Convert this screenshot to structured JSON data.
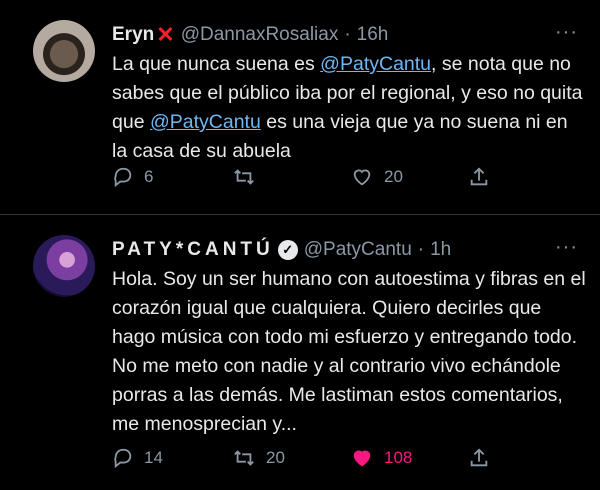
{
  "tweets": [
    {
      "name": "Eryn",
      "name_icon": "red-x-icon",
      "handle": "@DannaxRosaliax",
      "separator": "·",
      "time": "16h",
      "body": [
        {
          "t": "La que nunca suena es "
        },
        {
          "t": "@PatyCantu",
          "mention": true
        },
        {
          "t": ", se nota que no sabes que el público iba por el regional, y eso no quita que "
        },
        {
          "t": "@PatyCantu",
          "mention": true
        },
        {
          "t": "  es una vieja que ya no suena ni en la casa de su abuela"
        }
      ],
      "replies": "6",
      "retweets": "",
      "likes": "20",
      "liked": false
    },
    {
      "name": "PATY*CANTÚ",
      "name_icon": "verified-icon",
      "handle": "@PatyCantu",
      "separator": "·",
      "time": "1h",
      "body": [
        {
          "t": "Hola. Soy un ser humano con autoestima y fibras en el corazón igual que cualquiera. Quiero decirles que hago música con todo mi esfuerzo y entregando todo. No me meto con nadie y al contrario vivo echándole porras a las demás. Me lastiman estos comentarios, me menosprecian y..."
        }
      ],
      "replies": "14",
      "retweets": "20",
      "likes": "108",
      "liked": true
    }
  ],
  "colors": {
    "accent": "#1d9bf0",
    "like": "#f91880",
    "muted": "#8b98a5",
    "x_mark": "#f4212e"
  }
}
